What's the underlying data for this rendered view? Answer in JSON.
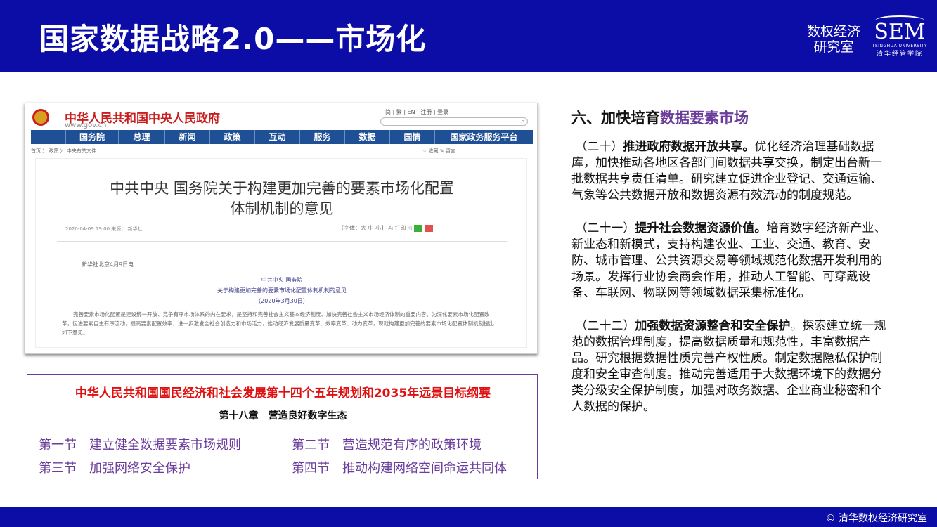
{
  "header": {
    "title": "国家数据战略2.0——市场化",
    "lab_name": "数权经济研究室",
    "logo_main": "SEM",
    "logo_sub_en": "TSINGHUA UNIVERSITY",
    "logo_sub_cn": "清华经管学院"
  },
  "screenshot": {
    "site_name": "中华人民共和国中央人民政府",
    "site_url": "www.gov.cn",
    "top_links": "简 | 繁 | EN | 注册 | 登录",
    "search_icon": "⌕",
    "nav": [
      "国务院",
      "总理",
      "新闻",
      "政策",
      "互动",
      "服务",
      "数据",
      "国情",
      "国家政务服务平台"
    ],
    "breadcrumb": "首页  〉 政策  〉 中央有关文件",
    "fav": "☆ 收藏    ✎ 留言",
    "article_title_1": "中共中央 国务院关于构建更加完善的要素市场化配置",
    "article_title_2": "体制机制的意见",
    "meta": "2020-04-09 19:00    来源： 新华社",
    "tools": "【字体：大 中 小】   ⎙ 打印    ⩤",
    "dateline": "新华社北京4月9日电",
    "issuer": "中共中央 国务院",
    "doc_title": "关于构建更加完善的要素市场化配置体制机制的意见",
    "doc_date": "（2020年3月30日）",
    "body": "完善要素市场化配置是建设统一开放、竞争有序市场体系的内在要求，是坚持和完善社会主义基本经济制度、加快完善社会主义市场经济体制的重要内容。为深化要素市场化配置改革，促进要素自主有序流动，提高要素配置效率，进一步激发全社会创造力和市场活力，推动经济发展质量变革、效率变革、动力变革，现就构建更加完善的要素市场化配置体制机制提出如下意见。"
  },
  "plan": {
    "title": "中华人民共和国国民经济和社会发展第十四个五年规划和2035年远景目标纲要",
    "chapter": "第十八章　营造良好数字生态",
    "sections": [
      "第一节　建立健全数据要素市场规则",
      "第二节　营造规范有序的政策环境",
      "第三节　加强网络安全保护",
      "第四节　推动构建网络空间命运共同体"
    ]
  },
  "right": {
    "heading_a": "六、加快培育",
    "heading_b": "数据要素市场",
    "paras": [
      {
        "num": "（二十）",
        "bold": "推进政府数据开放共享。",
        "text": "优化经济治理基础数据库，加快推动各地区各部门间数据共享交换，制定出台新一批数据共享责任清单。研究建立促进企业登记、交通运输、气象等公共数据开放和数据资源有效流动的制度规范。"
      },
      {
        "num": "（二十一）",
        "bold": "提升社会数据资源价值。",
        "text": "培育数字经济新产业、新业态和新模式，支持构建农业、工业、交通、教育、安防、城市管理、公共资源交易等领域规范化数据开发利用的场景。发挥行业协会商会作用，推动人工智能、可穿戴设备、车联网、物联网等领域数据采集标准化。"
      },
      {
        "num": "（二十二）",
        "bold": "加强数据资源整合和安全保护",
        "text": "。探索建立统一规范的数据管理制度，提高数据质量和规范性，丰富数据产品。研究根据数据性质完善产权性质。制定数据隐私保护制度和安全审查制度。推动完善适用于大数据环境下的数据分类分级安全保护制度，加强对政务数据、企业商业秘密和个人数据的保护。"
      }
    ]
  },
  "footer": {
    "copyright": "© 清华数权经济研究室"
  }
}
